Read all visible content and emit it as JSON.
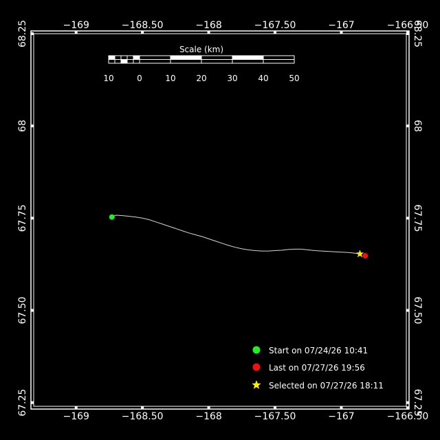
{
  "map": {
    "lon_range": [
      -169.32,
      -166.51
    ],
    "lat_range": [
      67.24,
      68.25
    ],
    "lon_ticks": [
      {
        "value": -169,
        "label": "−169"
      },
      {
        "value": -168.5,
        "label": "−168.50"
      },
      {
        "value": -168,
        "label": "−168"
      },
      {
        "value": -167.5,
        "label": "−167.50"
      },
      {
        "value": -167,
        "label": "−167"
      },
      {
        "value": -166.5,
        "label": "−166.50"
      }
    ],
    "lat_ticks": [
      {
        "value": 68.25,
        "label": "68.25"
      },
      {
        "value": 68,
        "label": "68"
      },
      {
        "value": 67.75,
        "label": "67.75"
      },
      {
        "value": 67.5,
        "label": "67.50"
      },
      {
        "value": 67.25,
        "label": "67.25"
      }
    ],
    "colors": {
      "background": "#000000",
      "frame": "#ffffff",
      "track": "#d8d8d8",
      "start": "#22ee22",
      "last": "#ee1111",
      "selected": "#ffee00"
    }
  },
  "scale_bar": {
    "title": "Scale (km)",
    "tick_labels": [
      "10",
      "0",
      "10",
      "20",
      "30",
      "40",
      "50"
    ]
  },
  "track": {
    "points": [
      [
        -168.73,
        67.754
      ],
      [
        -168.7,
        67.758
      ],
      [
        -168.65,
        67.757
      ],
      [
        -168.6,
        67.755
      ],
      [
        -168.55,
        67.753
      ],
      [
        -168.5,
        67.75
      ],
      [
        -168.45,
        67.746
      ],
      [
        -168.4,
        67.74
      ],
      [
        -168.35,
        67.734
      ],
      [
        -168.3,
        67.728
      ],
      [
        -168.25,
        67.722
      ],
      [
        -168.2,
        67.716
      ],
      [
        -168.15,
        67.71
      ],
      [
        -168.1,
        67.705
      ],
      [
        -168.05,
        67.7
      ],
      [
        -168.0,
        67.694
      ],
      [
        -167.95,
        67.688
      ],
      [
        -167.9,
        67.682
      ],
      [
        -167.85,
        67.676
      ],
      [
        -167.8,
        67.671
      ],
      [
        -167.75,
        67.667
      ],
      [
        -167.7,
        67.664
      ],
      [
        -167.65,
        67.662
      ],
      [
        -167.6,
        67.661
      ],
      [
        -167.55,
        67.661
      ],
      [
        -167.5,
        67.662
      ],
      [
        -167.45,
        67.663
      ],
      [
        -167.4,
        67.665
      ],
      [
        -167.35,
        67.666
      ],
      [
        -167.3,
        67.666
      ],
      [
        -167.25,
        67.664
      ],
      [
        -167.2,
        67.662
      ],
      [
        -167.15,
        67.661
      ],
      [
        -167.1,
        67.66
      ],
      [
        -167.05,
        67.659
      ],
      [
        -167.0,
        67.658
      ],
      [
        -166.95,
        67.657
      ],
      [
        -166.9,
        67.655
      ],
      [
        -166.86,
        67.653
      ]
    ]
  },
  "markers": {
    "start": {
      "lon": -168.73,
      "lat": 67.753
    },
    "last": {
      "lon": -166.82,
      "lat": 67.648
    },
    "selected": {
      "lon": -166.86,
      "lat": 67.653
    }
  },
  "legend": {
    "start_label": "Start on 07/24/26 10:41",
    "last_label": "Last on 07/27/26 19:56",
    "selected_label": "Selected on 07/27/26 18:11"
  }
}
